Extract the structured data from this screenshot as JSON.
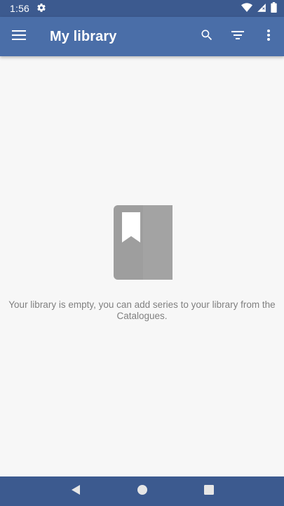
{
  "status_bar": {
    "time": "1:56"
  },
  "app_bar": {
    "title": "My library"
  },
  "empty_state": {
    "message": "Your library is empty, you can add series to your library from the Catalogues."
  },
  "colors": {
    "status_bar": "#3c5a8f",
    "app_bar": "#4a6ea8",
    "nav_bar": "#3c5a8f",
    "empty_icon": "#9e9e9e",
    "message_text": "#808080"
  },
  "icons": {
    "menu": "menu-icon",
    "search": "search-icon",
    "filter": "filter-icon",
    "more": "more-vert-icon",
    "empty": "bookmark-book-icon",
    "back": "back-triangle-icon",
    "home": "home-circle-icon",
    "recents": "recents-square-icon"
  }
}
